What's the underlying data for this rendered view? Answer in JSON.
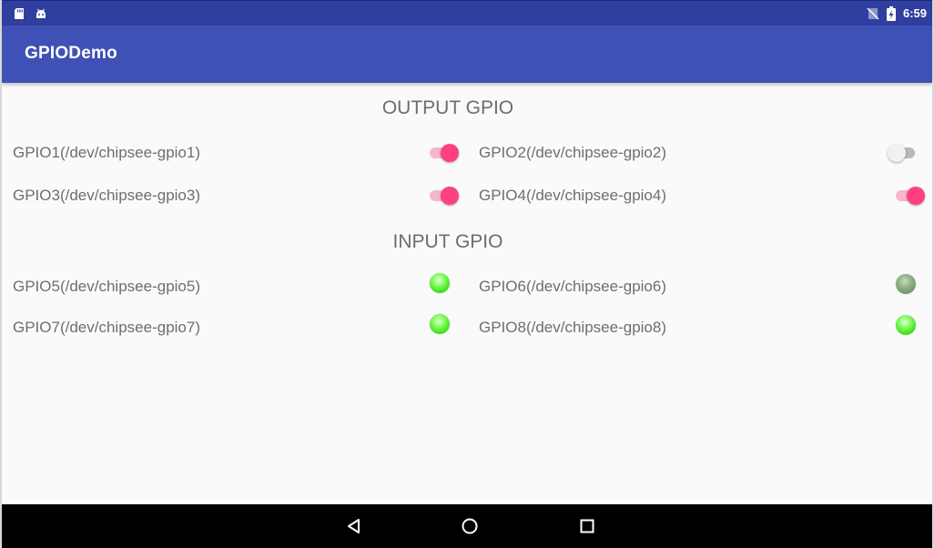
{
  "status_bar": {
    "time": "6:59",
    "icons": [
      "sd-card-icon",
      "android-icon",
      "no-sim-icon",
      "battery-charging-icon"
    ]
  },
  "app_bar": {
    "title": "GPIODemo"
  },
  "output_section": {
    "title": "OUTPUT GPIO",
    "items": [
      {
        "label": "GPIO1(/dev/chipsee-gpio1)",
        "state": "on"
      },
      {
        "label": "GPIO2(/dev/chipsee-gpio2)",
        "state": "off"
      },
      {
        "label": "GPIO3(/dev/chipsee-gpio3)",
        "state": "on"
      },
      {
        "label": "GPIO4(/dev/chipsee-gpio4)",
        "state": "on"
      }
    ]
  },
  "input_section": {
    "title": "INPUT GPIO",
    "items": [
      {
        "label": "GPIO5(/dev/chipsee-gpio5)",
        "state": "on"
      },
      {
        "label": "GPIO6(/dev/chipsee-gpio6)",
        "state": "off"
      },
      {
        "label": "GPIO7(/dev/chipsee-gpio7)",
        "state": "on"
      },
      {
        "label": "GPIO8(/dev/chipsee-gpio8)",
        "state": "on"
      }
    ]
  },
  "nav_bar": {
    "buttons": [
      "back-icon",
      "home-icon",
      "recents-icon"
    ]
  },
  "colors": {
    "status_bar": "#303f9f",
    "app_bar": "#3f51b5",
    "switch_on_thumb": "#ff4081",
    "led_on": "#3fe01a",
    "led_off": "#6f9667"
  }
}
